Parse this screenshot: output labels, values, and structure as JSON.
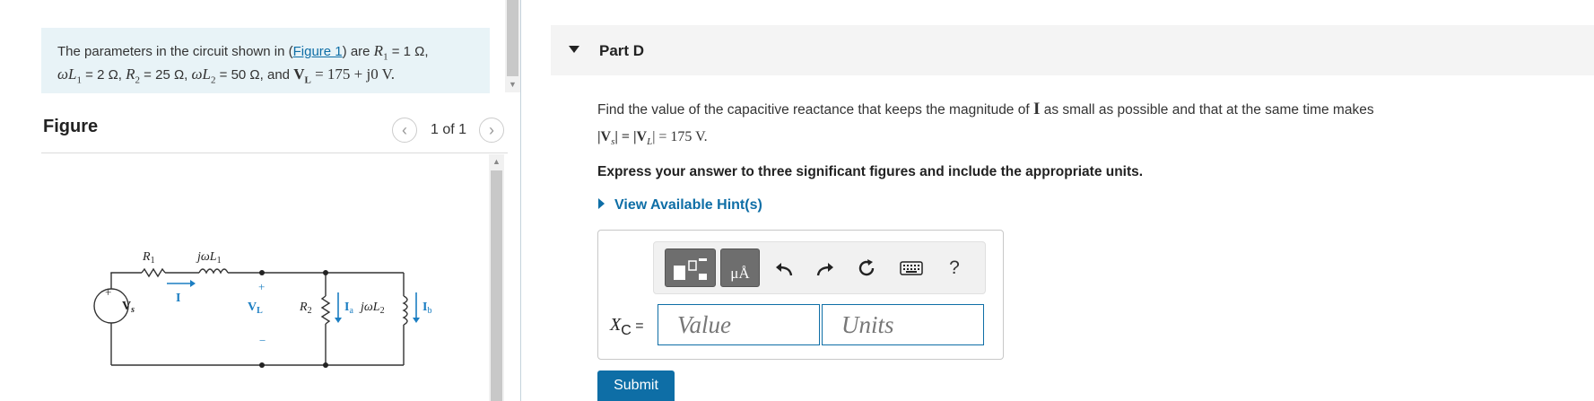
{
  "problem": {
    "intro": "The parameters in the circuit shown in (",
    "figure_link": "Figure 1",
    "after_link": ") are ",
    "r1_sym": "R",
    "r1_sub": "1",
    "r1_val": " = 1 Ω,",
    "wl1_sym": "ωL",
    "wl1_sub": "1",
    "wl1_val": " = 2 Ω, ",
    "r2_sym": "R",
    "r2_sub": "2",
    "r2_val": " = 25 Ω, ",
    "wl2_sym": "ωL",
    "wl2_sub": "2",
    "wl2_val": " = 50 Ω, and ",
    "vl_sym": "V",
    "vl_sub": "L",
    "vl_val": " = 175 + j0 V."
  },
  "figure": {
    "title": "Figure",
    "counter": "1 of 1",
    "prev_icon": "chevron-left-icon",
    "next_icon": "chevron-right-icon",
    "labels": {
      "r1": "R",
      "r1_sub": "1",
      "jwl1": "jωL",
      "jwl1_sub": "1",
      "current_i": "I",
      "vs": "V",
      "vs_sub": "s",
      "plus_top": "+",
      "minus_bottom": "−",
      "vl": "V",
      "vl_sub": "L",
      "r2": "R",
      "r2_sub": "2",
      "ia": "I",
      "ia_sub": "a",
      "jwl2": "jωL",
      "jwl2_sub": "2",
      "ib": "I",
      "ib_sub": "b",
      "source_plus": "+",
      "source_minus": "−"
    }
  },
  "part": {
    "title": "Part D",
    "question_text": "Find the value of the capacitive reactance that keeps the magnitude of ",
    "question_sym": "I",
    "question_text2": " as small as possible and that at the same time makes",
    "eq_left": "|V",
    "eq_left_sub": "s",
    "eq_mid": "| = |V",
    "eq_mid_sub": "L",
    "eq_right_num": "| = 175",
    "eq_right_unit": " V.",
    "instruction": "Express your answer to three significant figures and include the appropriate units.",
    "hint_label": "View Available Hint(s)"
  },
  "answer": {
    "label_sym": "X",
    "label_sub": "C",
    "label_eq": " =",
    "value_placeholder": "Value",
    "units_placeholder": "Units",
    "submit": "Submit",
    "toolbar_unit_glyph": "μÅ",
    "help": "?"
  },
  "colors": {
    "accent": "#0e6ea6",
    "problem_bg": "#e8f3f7",
    "circuit_blue": "#1b7ec2"
  }
}
